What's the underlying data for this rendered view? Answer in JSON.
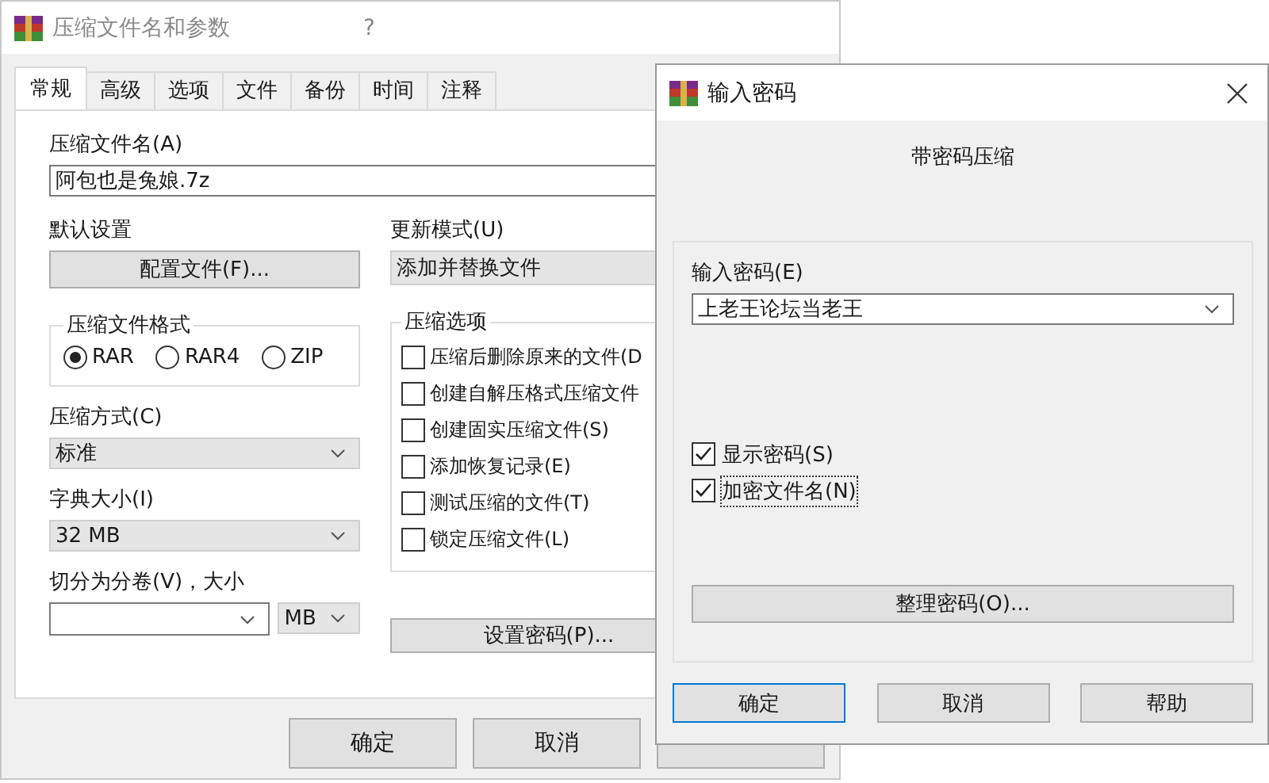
{
  "main_window": {
    "title": "压缩文件名和参数",
    "help_glyph": "?"
  },
  "tabs": [
    {
      "label": "常规",
      "selected": true
    },
    {
      "label": "高级",
      "selected": false
    },
    {
      "label": "选项",
      "selected": false
    },
    {
      "label": "文件",
      "selected": false
    },
    {
      "label": "备份",
      "selected": false
    },
    {
      "label": "时间",
      "selected": false
    },
    {
      "label": "注释",
      "selected": false
    }
  ],
  "archive_name": {
    "label": "压缩文件名(A)",
    "value": "阿包也是兔娘.7z"
  },
  "profiles": {
    "label": "默认设置",
    "button": "配置文件(F)..."
  },
  "update_mode": {
    "label": "更新模式(U)",
    "value": "添加并替换文件"
  },
  "archive_format": {
    "title": "压缩文件格式",
    "options": [
      {
        "label": "RAR",
        "selected": true
      },
      {
        "label": "RAR4",
        "selected": false
      },
      {
        "label": "ZIP",
        "selected": false
      }
    ]
  },
  "compression_method": {
    "label": "压缩方式(C)",
    "value": "标准"
  },
  "dictionary_size": {
    "label": "字典大小(I)",
    "value": "32 MB"
  },
  "split_volumes": {
    "label": "切分为分卷(V)，大小",
    "unit": "MB"
  },
  "archiving_options": {
    "title": "压缩选项",
    "items": [
      {
        "label": "压缩后删除原来的文件(D",
        "checked": false
      },
      {
        "label": "创建自解压格式压缩文件",
        "checked": false
      },
      {
        "label": "创建固实压缩文件(S)",
        "checked": false
      },
      {
        "label": "添加恢复记录(E)",
        "checked": false
      },
      {
        "label": "测试压缩的文件(T)",
        "checked": false
      },
      {
        "label": "锁定压缩文件(L)",
        "checked": false
      }
    ]
  },
  "set_password_button": "设置密码(P)...",
  "buttons": [
    "确定",
    "取消"
  ],
  "password_dialog": {
    "title": "输入密码",
    "heading": "带密码压缩",
    "password": {
      "label": "输入密码(E)",
      "value": "上老王论坛当老王"
    },
    "options": [
      {
        "label": "显示密码(S)",
        "checked": true,
        "focused": false
      },
      {
        "label": "加密文件名(N)",
        "checked": true,
        "focused": true
      }
    ],
    "organize_button": "整理密码(O)...",
    "buttons": [
      {
        "label": "确定",
        "default": true
      },
      {
        "label": "取消",
        "default": false
      },
      {
        "label": "帮助",
        "default": false
      }
    ]
  }
}
